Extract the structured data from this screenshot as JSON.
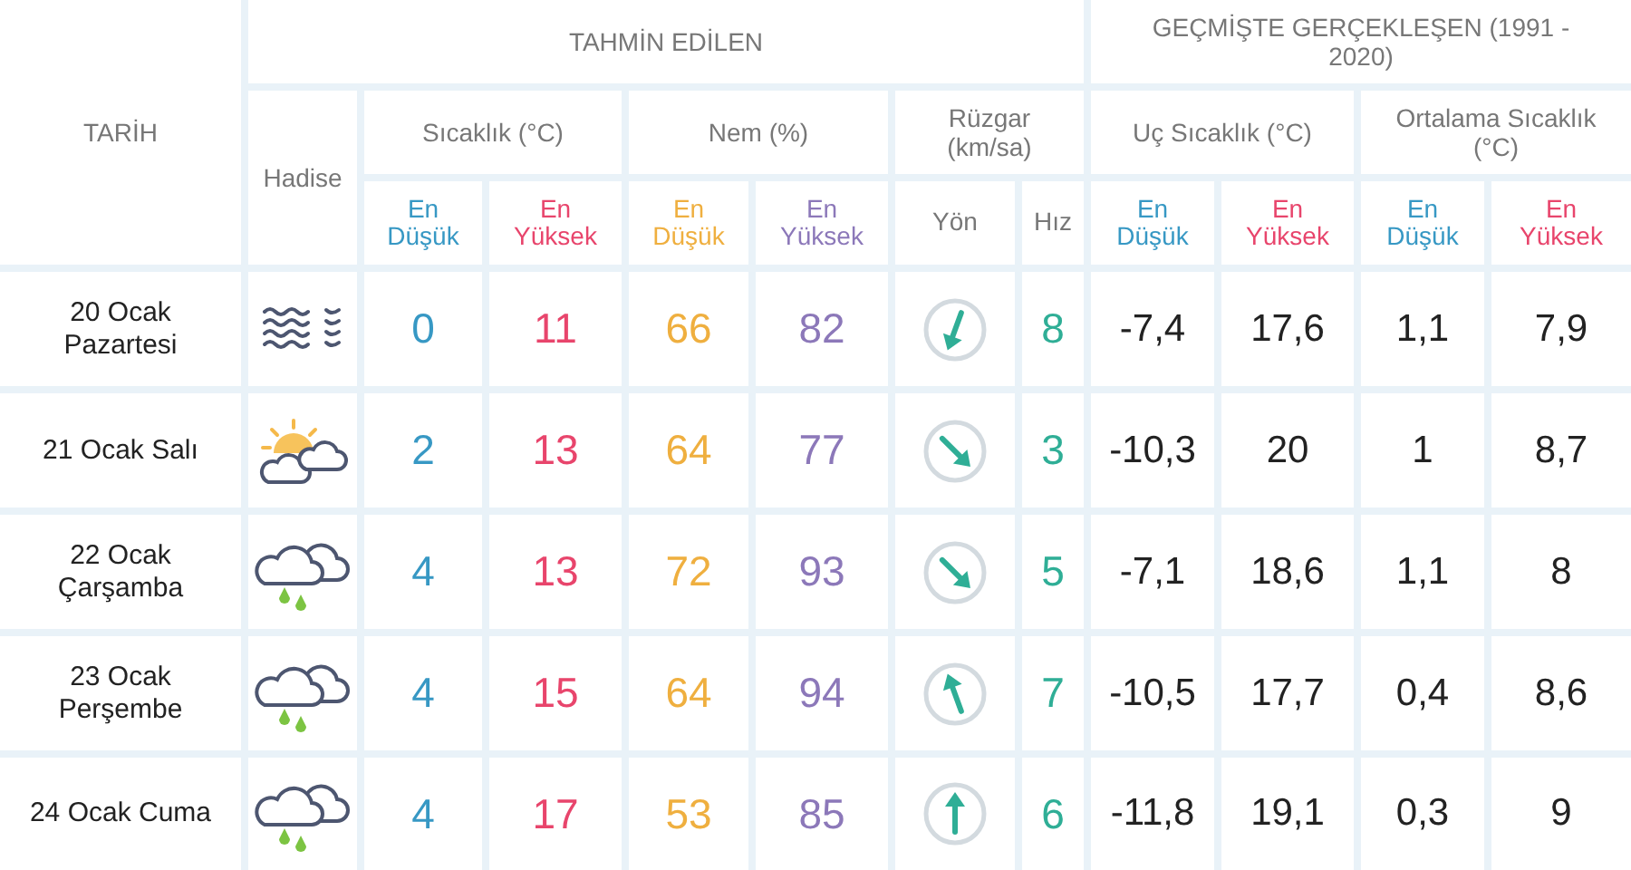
{
  "header": {
    "date": "TARİH",
    "forecast": "TAHMİN EDİLEN",
    "history": "GEÇMİŞTE GERÇEKLEŞEN (1991 - 2020)",
    "event": "Hadise",
    "temperature": "Sıcaklık (°C)",
    "humidity": "Nem (%)",
    "wind": "Rüzgar (km/sa)",
    "extreme": "Uç Sıcaklık (°C)",
    "average": "Ortalama Sıcaklık (°C)",
    "subheaders": [
      "En Düşük",
      "En Yüksek",
      "En Düşük",
      "En Yüksek",
      "Yön",
      "Hız",
      "En Düşük",
      "En Yüksek",
      "En Düşük",
      "En Yüksek"
    ]
  },
  "rows": [
    {
      "date": "20 Ocak Pazartesi",
      "weather": {
        "kind": "fog"
      },
      "temp_low": "0",
      "temp_high": "11",
      "humidity_low": "66",
      "humidity_high": "82",
      "wind_arrow": {
        "kind": "ssw"
      },
      "wind_speed": "8",
      "extreme_low": "-7,4",
      "extreme_high": "17,6",
      "average_low": "1,1",
      "average_high": "7,9"
    },
    {
      "date": "21 Ocak Salı",
      "weather": {
        "kind": "sunny_cloudy"
      },
      "temp_low": "2",
      "temp_high": "13",
      "humidity_low": "64",
      "humidity_high": "77",
      "wind_arrow": {
        "kind": "se"
      },
      "wind_speed": "3",
      "extreme_low": "-10,3",
      "extreme_high": "20",
      "average_low": "1",
      "average_high": "8,7"
    },
    {
      "date": "22 Ocak Çarşamba",
      "weather": {
        "kind": "rain"
      },
      "temp_low": "4",
      "temp_high": "13",
      "humidity_low": "72",
      "humidity_high": "93",
      "wind_arrow": {
        "kind": "se"
      },
      "wind_speed": "5",
      "extreme_low": "-7,1",
      "extreme_high": "18,6",
      "average_low": "1,1",
      "average_high": "8"
    },
    {
      "date": "23 Ocak Perşembe",
      "weather": {
        "kind": "rain"
      },
      "temp_low": "4",
      "temp_high": "15",
      "humidity_low": "64",
      "humidity_high": "94",
      "wind_arrow": {
        "kind": "nnw"
      },
      "wind_speed": "7",
      "extreme_low": "-10,5",
      "extreme_high": "17,7",
      "average_low": "0,4",
      "average_high": "8,6"
    },
    {
      "date": "24 Ocak Cuma",
      "weather": {
        "kind": "rain"
      },
      "temp_low": "4",
      "temp_high": "17",
      "humidity_low": "53",
      "humidity_high": "85",
      "wind_arrow": {
        "kind": "n"
      },
      "wind_speed": "6",
      "extreme_low": "-11,8",
      "extreme_high": "19,1",
      "average_low": "0,3",
      "average_high": "9"
    }
  ]
}
